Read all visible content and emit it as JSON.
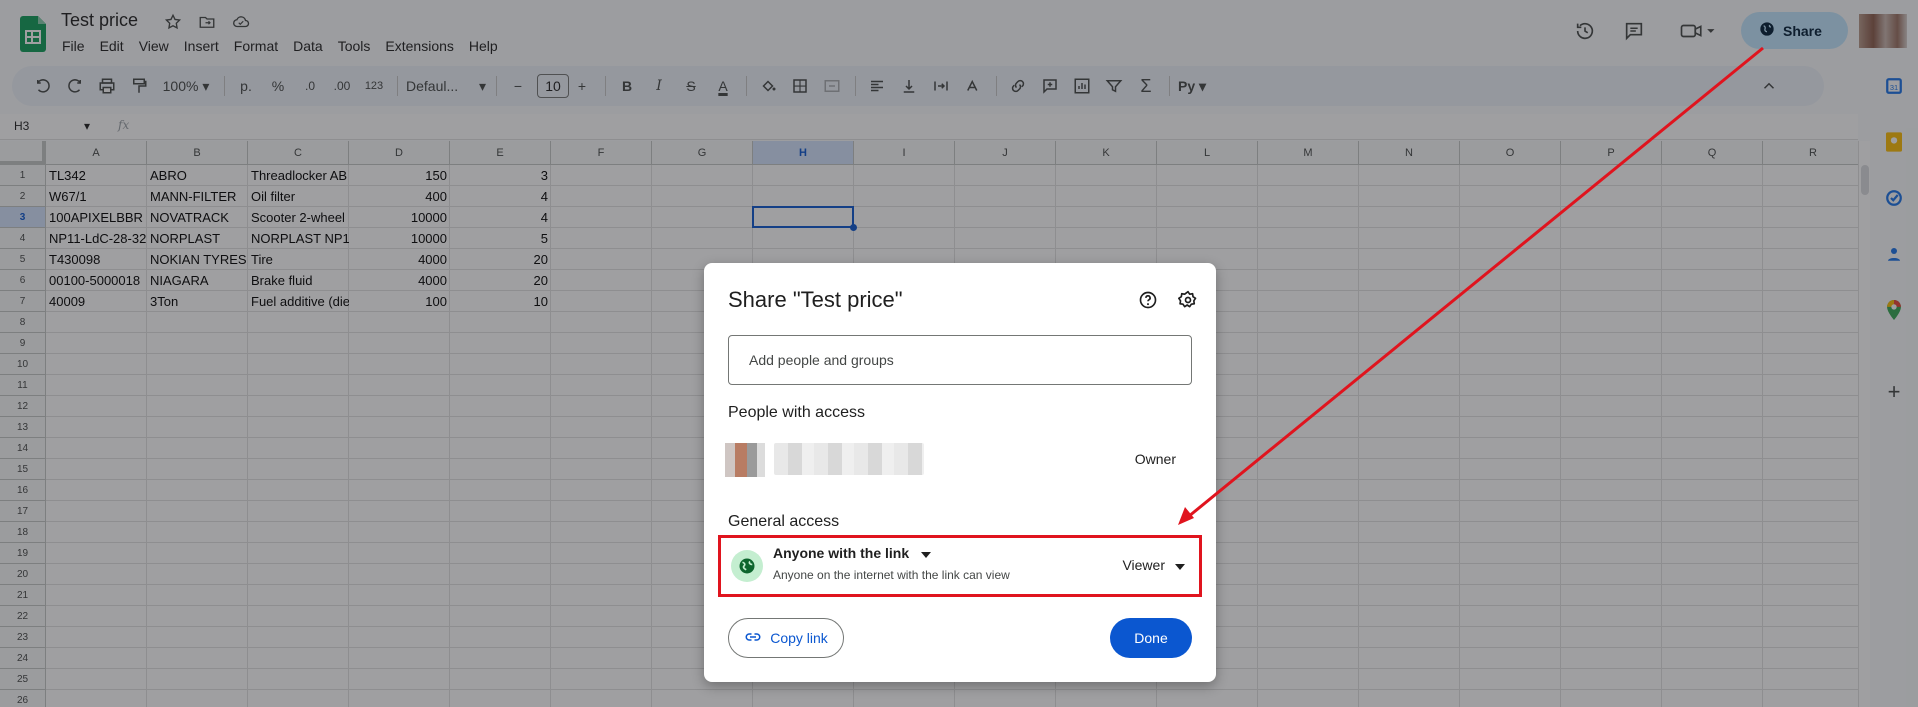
{
  "app": {
    "title": "Test price",
    "menu": [
      "File",
      "Edit",
      "View",
      "Insert",
      "Format",
      "Data",
      "Tools",
      "Extensions",
      "Help"
    ],
    "share_label": "Share"
  },
  "toolbar": {
    "zoom": "100%",
    "currency_format": "р.",
    "percent_format": "%",
    "decrease_decimal": ".0",
    "increase_decimal": ".00",
    "number_format": "123",
    "font": "Defaul...",
    "font_size": "10"
  },
  "formula_bar": {
    "name_box": "H3",
    "fx": "fx"
  },
  "sheet": {
    "columns": [
      "A",
      "B",
      "C",
      "D",
      "E",
      "F",
      "G",
      "H",
      "I",
      "J",
      "K",
      "L",
      "M",
      "N",
      "O",
      "P",
      "Q",
      "R"
    ],
    "selected_column": "H",
    "rows": [
      "1",
      "2",
      "3",
      "4",
      "5",
      "6",
      "7",
      "8",
      "9",
      "10",
      "11",
      "12",
      "13",
      "14",
      "15",
      "16",
      "17",
      "18",
      "19",
      "20",
      "21",
      "22",
      "23",
      "24",
      "25",
      "26"
    ],
    "selected_row": "3",
    "data": [
      [
        "TL342",
        "ABRO",
        "Threadlocker AB",
        "150",
        "3"
      ],
      [
        "W67/1",
        "MANN-FILTER",
        "Oil filter",
        "400",
        "4"
      ],
      [
        "100APIXELBBR",
        "NOVATRACK",
        "Scooter 2-wheel",
        "10000",
        "4"
      ],
      [
        "NP11-LdC-28-32",
        "NORPLAST",
        "NORPLAST NP1",
        "10000",
        "5"
      ],
      [
        "T430098",
        "NOKIAN TYRES",
        "Tire",
        "4000",
        "20"
      ],
      [
        "00100-5000018",
        "NIAGARA",
        "Brake fluid",
        "4000",
        "20"
      ],
      [
        "40009",
        "3Ton",
        "Fuel additive (die",
        "100",
        "10"
      ]
    ]
  },
  "dialog": {
    "title": "Share \"Test price\"",
    "add_placeholder": "Add people and groups",
    "people_heading": "People with access",
    "owner_role": "Owner",
    "general_heading": "General access",
    "access_option": "Anyone with the link",
    "access_description": "Anyone on the internet with the link can view",
    "role": "Viewer",
    "copy_link": "Copy link",
    "done": "Done"
  },
  "colors": {
    "accent": "#0b57d0",
    "share_bg": "#c2e7ff",
    "annotation": "#e0141e",
    "globe_bg": "#c4eed0"
  }
}
